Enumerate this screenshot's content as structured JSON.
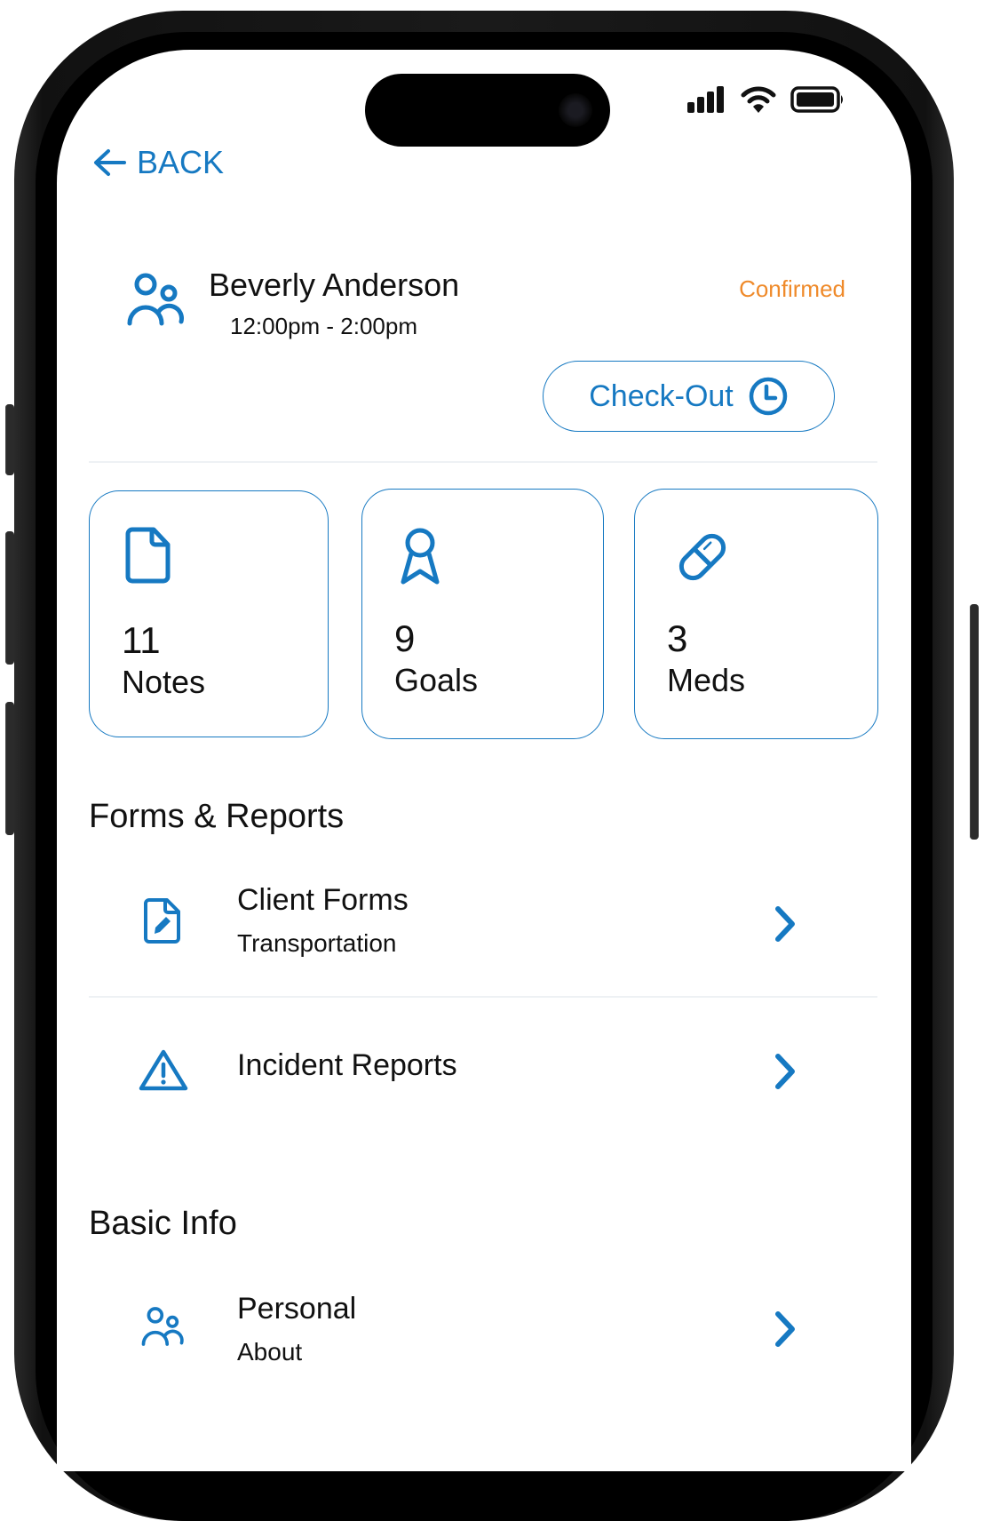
{
  "status_bar": {
    "icons": [
      "cellular-signal-icon",
      "wifi-icon",
      "battery-icon"
    ]
  },
  "nav": {
    "back_label": "BACK",
    "back_icon": "arrow-left-icon"
  },
  "client": {
    "name": "Beverly Anderson",
    "time_range": "12:00pm - 2:00pm",
    "status": "Confirmed",
    "icon": "users-icon"
  },
  "checkout": {
    "label": "Check-Out",
    "icon": "clock-icon"
  },
  "stats": [
    {
      "count": "11",
      "label": "Notes",
      "icon": "document-icon"
    },
    {
      "count": "9",
      "label": "Goals",
      "icon": "award-ribbon-icon"
    },
    {
      "count": "3",
      "label": "Meds",
      "icon": "pill-icon"
    }
  ],
  "sections": [
    {
      "title": "Forms & Reports",
      "items": [
        {
          "title": "Client Forms",
          "subtitle": "Transportation",
          "icon": "document-edit-icon"
        },
        {
          "title": "Incident Reports",
          "subtitle": "",
          "icon": "warning-triangle-icon"
        }
      ]
    },
    {
      "title": "Basic Info",
      "items": [
        {
          "title": "Personal",
          "subtitle": "About",
          "icon": "users-icon"
        }
      ]
    }
  ],
  "colors": {
    "accent": "#1679c2",
    "status_confirmed": "#ef8a2a",
    "text": "#111111"
  }
}
